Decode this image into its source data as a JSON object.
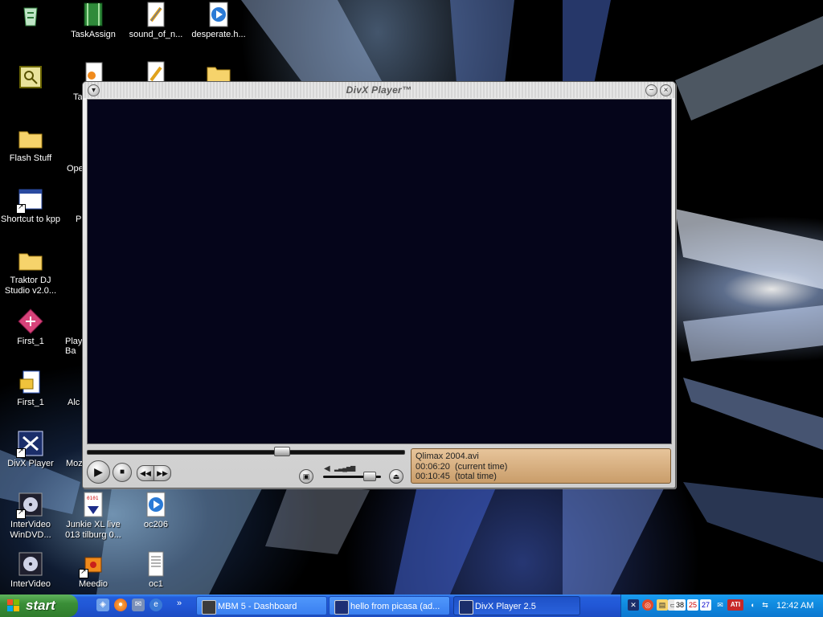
{
  "desktop": {
    "icons": [
      {
        "name": "recycle-bin-icon",
        "label": ""
      },
      {
        "name": "task-assign-icon",
        "label": "TaskAssign"
      },
      {
        "name": "sound-of-file-icon",
        "label": "sound_of_n..."
      },
      {
        "name": "desperate-media-icon",
        "label": "desperate.h..."
      },
      {
        "name": "certificate-app-icon",
        "label": ""
      },
      {
        "name": "flash-stuff-folder-icon",
        "label": "Flash Stuff"
      },
      {
        "name": "kpp-shortcut-icon",
        "label": "Shortcut to kpp"
      },
      {
        "name": "traktor-folder-icon",
        "label": "Traktor DJ\nStudio v2.0..."
      },
      {
        "name": "first-1-diamond-icon",
        "label": "First_1"
      },
      {
        "name": "first-1-file-icon",
        "label": "First_1"
      },
      {
        "name": "divx-player-desktop-icon",
        "label": "DivX Player"
      },
      {
        "name": "intervideo-windvd-icon",
        "label": "InterVideo\nWinDVD..."
      },
      {
        "name": "junkie-xl-icon",
        "label": "Junkie XL live\n013 tilburg 0..."
      },
      {
        "name": "oc206-icon",
        "label": "oc206"
      },
      {
        "name": "intervideo-icon-2",
        "label": "InterVideo"
      },
      {
        "name": "meedio-icon",
        "label": "Meedio"
      },
      {
        "name": "oc1-icon",
        "label": "oc1"
      }
    ],
    "partial_labels": [
      "Ta",
      "Ope",
      "P",
      "Play\nBa",
      "Alc",
      "Moz"
    ]
  },
  "player": {
    "title": "DivX Player™",
    "seek_fraction": 0.62,
    "volume_fraction": 0.86,
    "info": {
      "file": "Qlimax 2004.avi",
      "current_time": "00:06:20",
      "current_label": "(current time)",
      "total_time": "00:10:45",
      "total_label": "(total time)"
    }
  },
  "taskbar": {
    "start_label": "start",
    "tasks": [
      {
        "label": "MBM 5 - Dashboard",
        "icon": "chip-icon"
      },
      {
        "label": "hello from picasa (ad...",
        "icon": "picasa-icon"
      },
      {
        "label": "DivX Player 2.5",
        "icon": "divx-icon"
      }
    ],
    "tray_numbers": [
      "38",
      "25",
      "27"
    ],
    "tray_brand": "ATI",
    "clock": "12:42 AM"
  },
  "colors": {
    "taskbar_blue": "#245edb",
    "start_green": "#3a8e37",
    "video_bg": "#05051a",
    "info_panel": "#d8b080"
  }
}
